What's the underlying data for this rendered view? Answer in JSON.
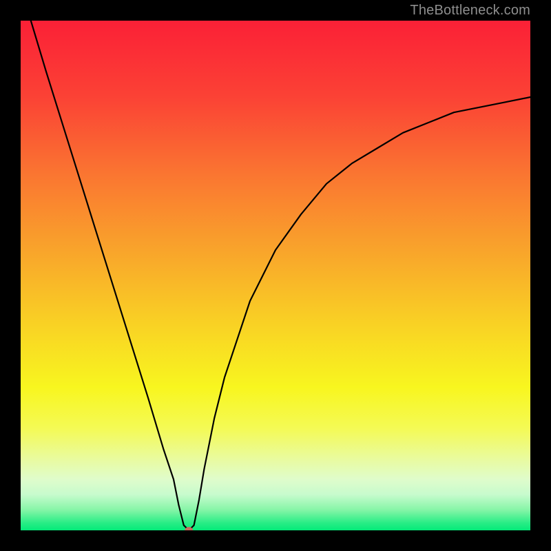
{
  "watermark": "TheBottleneck.com",
  "chart_data": {
    "type": "line",
    "title": "",
    "xlabel": "",
    "ylabel": "",
    "xlim": [
      0,
      100
    ],
    "ylim": [
      0,
      100
    ],
    "grid": false,
    "legend": false,
    "series": [
      {
        "name": "curve",
        "x": [
          2,
          5,
          10,
          15,
          20,
          25,
          28,
          30,
          31,
          32,
          33,
          34,
          35,
          36,
          38,
          40,
          45,
          50,
          55,
          60,
          65,
          70,
          75,
          80,
          85,
          90,
          95,
          100
        ],
        "y": [
          100,
          90,
          74,
          58,
          42,
          26,
          16,
          10,
          5,
          1,
          0,
          1,
          6,
          12,
          22,
          30,
          45,
          55,
          62,
          68,
          72,
          75,
          78,
          80,
          82,
          83,
          84,
          85
        ]
      }
    ],
    "annotations": [
      {
        "name": "minimum-marker",
        "x": 33,
        "y": 0,
        "rx": 6,
        "ry": 5,
        "fill": "#c96a5e"
      }
    ],
    "background_gradient": {
      "stops": [
        {
          "offset": 0.0,
          "color": "#fb2036"
        },
        {
          "offset": 0.15,
          "color": "#fb4235"
        },
        {
          "offset": 0.3,
          "color": "#fa7531"
        },
        {
          "offset": 0.45,
          "color": "#f9a42b"
        },
        {
          "offset": 0.6,
          "color": "#f9d324"
        },
        {
          "offset": 0.72,
          "color": "#f8f61f"
        },
        {
          "offset": 0.8,
          "color": "#f4fa55"
        },
        {
          "offset": 0.86,
          "color": "#e9fb9f"
        },
        {
          "offset": 0.9,
          "color": "#dffccb"
        },
        {
          "offset": 0.93,
          "color": "#c7fbcd"
        },
        {
          "offset": 0.96,
          "color": "#85f5a7"
        },
        {
          "offset": 0.985,
          "color": "#2aed86"
        },
        {
          "offset": 1.0,
          "color": "#04ea79"
        }
      ]
    }
  }
}
